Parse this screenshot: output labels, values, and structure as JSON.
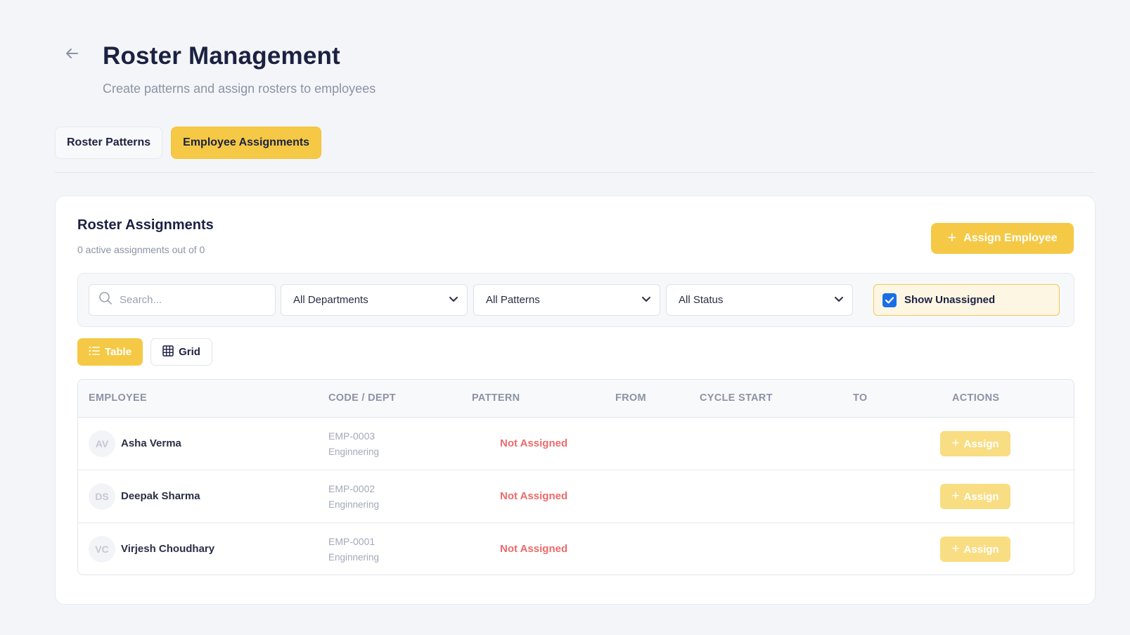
{
  "header": {
    "title": "Roster Management",
    "subtitle": "Create patterns and assign rosters to employees"
  },
  "tabs": [
    {
      "label": "Roster Patterns",
      "active": false
    },
    {
      "label": "Employee Assignments",
      "active": true
    }
  ],
  "card": {
    "title": "Roster Assignments",
    "subtitle": "0 active assignments out of 0",
    "assign_button_label": "Assign Employee"
  },
  "filters": {
    "search_placeholder": "Search...",
    "department": "All Departments",
    "pattern": "All Patterns",
    "status": "All Status",
    "show_unassigned_label": "Show Unassigned",
    "show_unassigned_checked": true
  },
  "view_toggle": {
    "table_label": "Table",
    "grid_label": "Grid",
    "active": "table"
  },
  "table": {
    "columns": [
      "EMPLOYEE",
      "CODE / DEPT",
      "PATTERN",
      "FROM",
      "CYCLE START",
      "TO",
      "ACTIONS"
    ],
    "rows": [
      {
        "initials": "AV",
        "name": "Asha Verma",
        "code": "EMP-0003",
        "dept": "Enginnering",
        "pattern": "Not Assigned",
        "action": "Assign"
      },
      {
        "initials": "DS",
        "name": "Deepak Sharma",
        "code": "EMP-0002",
        "dept": "Enginnering",
        "pattern": "Not Assigned",
        "action": "Assign"
      },
      {
        "initials": "VC",
        "name": "Virjesh Choudhary",
        "code": "EMP-0001",
        "dept": "Enginnering",
        "pattern": "Not Assigned",
        "action": "Assign"
      }
    ]
  },
  "colors": {
    "accent": "#f5c945",
    "accent_light": "#f9dd82",
    "danger_text": "#ec6b6b",
    "checkbox": "#1a6ee6"
  }
}
